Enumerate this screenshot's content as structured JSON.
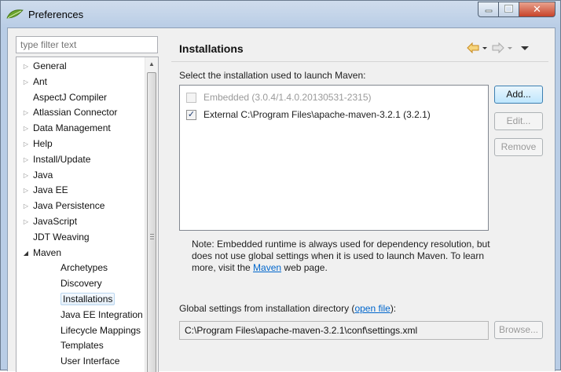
{
  "window": {
    "title": "Preferences",
    "controls": {
      "minimize": "–",
      "maximize": "☐",
      "close": "✕"
    }
  },
  "filter": {
    "placeholder": "type filter text"
  },
  "tree": {
    "items": [
      {
        "label": "General",
        "expander": "closed"
      },
      {
        "label": "Ant",
        "expander": "closed"
      },
      {
        "label": "AspectJ Compiler",
        "expander": "none"
      },
      {
        "label": "Atlassian Connector",
        "expander": "closed"
      },
      {
        "label": "Data Management",
        "expander": "closed"
      },
      {
        "label": "Help",
        "expander": "closed"
      },
      {
        "label": "Install/Update",
        "expander": "closed"
      },
      {
        "label": "Java",
        "expander": "closed"
      },
      {
        "label": "Java EE",
        "expander": "closed"
      },
      {
        "label": "Java Persistence",
        "expander": "closed"
      },
      {
        "label": "JavaScript",
        "expander": "closed"
      },
      {
        "label": "JDT Weaving",
        "expander": "none"
      },
      {
        "label": "Maven",
        "expander": "open"
      }
    ],
    "children": [
      {
        "label": "Archetypes"
      },
      {
        "label": "Discovery"
      },
      {
        "label": "Installations",
        "selected": true
      },
      {
        "label": "Java EE Integration"
      },
      {
        "label": "Lifecycle Mappings"
      },
      {
        "label": "Templates"
      },
      {
        "label": "User Interface"
      }
    ]
  },
  "panel": {
    "title": "Installations",
    "prompt": "Select the installation used to launch Maven:",
    "installations": [
      {
        "label": "Embedded (3.0.4/1.4.0.20130531-2315)",
        "checked": false,
        "enabled": false
      },
      {
        "label": "External C:\\Program Files\\apache-maven-3.2.1 (3.2.1)",
        "checked": true,
        "enabled": true
      }
    ],
    "buttons": {
      "add": "Add...",
      "edit": "Edit...",
      "remove": "Remove",
      "browse": "Browse..."
    },
    "note_before": "Note: Embedded runtime is always used for dependency resolution, but does not use global settings when it is used to launch Maven. To learn more, visit the ",
    "note_link": "Maven",
    "note_after": " web page.",
    "global_label_before": "Global settings from installation directory (",
    "global_label_link": "open file",
    "global_label_after": "):",
    "global_path": "C:\\Program Files\\apache-maven-3.2.1\\conf\\settings.xml"
  },
  "colors": {
    "link": "#0066cc",
    "nav_back": "#e8a33a",
    "nav_forward": "#a0a0a0",
    "selection": "#e4eff9"
  }
}
